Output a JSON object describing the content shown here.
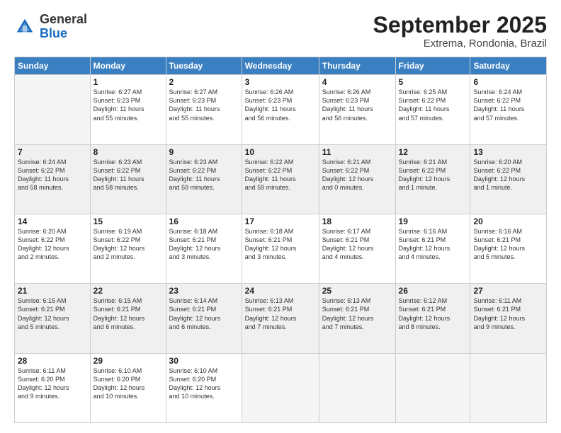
{
  "header": {
    "logo_general": "General",
    "logo_blue": "Blue",
    "month_title": "September 2025",
    "subtitle": "Extrema, Rondonia, Brazil"
  },
  "days_of_week": [
    "Sunday",
    "Monday",
    "Tuesday",
    "Wednesday",
    "Thursday",
    "Friday",
    "Saturday"
  ],
  "weeks": [
    [
      {
        "day": "",
        "info": ""
      },
      {
        "day": "1",
        "info": "Sunrise: 6:27 AM\nSunset: 6:23 PM\nDaylight: 11 hours\nand 55 minutes."
      },
      {
        "day": "2",
        "info": "Sunrise: 6:27 AM\nSunset: 6:23 PM\nDaylight: 11 hours\nand 55 minutes."
      },
      {
        "day": "3",
        "info": "Sunrise: 6:26 AM\nSunset: 6:23 PM\nDaylight: 11 hours\nand 56 minutes."
      },
      {
        "day": "4",
        "info": "Sunrise: 6:26 AM\nSunset: 6:23 PM\nDaylight: 11 hours\nand 56 minutes."
      },
      {
        "day": "5",
        "info": "Sunrise: 6:25 AM\nSunset: 6:22 PM\nDaylight: 11 hours\nand 57 minutes."
      },
      {
        "day": "6",
        "info": "Sunrise: 6:24 AM\nSunset: 6:22 PM\nDaylight: 11 hours\nand 57 minutes."
      }
    ],
    [
      {
        "day": "7",
        "info": "Sunrise: 6:24 AM\nSunset: 6:22 PM\nDaylight: 11 hours\nand 58 minutes."
      },
      {
        "day": "8",
        "info": "Sunrise: 6:23 AM\nSunset: 6:22 PM\nDaylight: 11 hours\nand 58 minutes."
      },
      {
        "day": "9",
        "info": "Sunrise: 6:23 AM\nSunset: 6:22 PM\nDaylight: 11 hours\nand 59 minutes."
      },
      {
        "day": "10",
        "info": "Sunrise: 6:22 AM\nSunset: 6:22 PM\nDaylight: 11 hours\nand 59 minutes."
      },
      {
        "day": "11",
        "info": "Sunrise: 6:21 AM\nSunset: 6:22 PM\nDaylight: 12 hours\nand 0 minutes."
      },
      {
        "day": "12",
        "info": "Sunrise: 6:21 AM\nSunset: 6:22 PM\nDaylight: 12 hours\nand 1 minute."
      },
      {
        "day": "13",
        "info": "Sunrise: 6:20 AM\nSunset: 6:22 PM\nDaylight: 12 hours\nand 1 minute."
      }
    ],
    [
      {
        "day": "14",
        "info": "Sunrise: 6:20 AM\nSunset: 6:22 PM\nDaylight: 12 hours\nand 2 minutes."
      },
      {
        "day": "15",
        "info": "Sunrise: 6:19 AM\nSunset: 6:22 PM\nDaylight: 12 hours\nand 2 minutes."
      },
      {
        "day": "16",
        "info": "Sunrise: 6:18 AM\nSunset: 6:21 PM\nDaylight: 12 hours\nand 3 minutes."
      },
      {
        "day": "17",
        "info": "Sunrise: 6:18 AM\nSunset: 6:21 PM\nDaylight: 12 hours\nand 3 minutes."
      },
      {
        "day": "18",
        "info": "Sunrise: 6:17 AM\nSunset: 6:21 PM\nDaylight: 12 hours\nand 4 minutes."
      },
      {
        "day": "19",
        "info": "Sunrise: 6:16 AM\nSunset: 6:21 PM\nDaylight: 12 hours\nand 4 minutes."
      },
      {
        "day": "20",
        "info": "Sunrise: 6:16 AM\nSunset: 6:21 PM\nDaylight: 12 hours\nand 5 minutes."
      }
    ],
    [
      {
        "day": "21",
        "info": "Sunrise: 6:15 AM\nSunset: 6:21 PM\nDaylight: 12 hours\nand 5 minutes."
      },
      {
        "day": "22",
        "info": "Sunrise: 6:15 AM\nSunset: 6:21 PM\nDaylight: 12 hours\nand 6 minutes."
      },
      {
        "day": "23",
        "info": "Sunrise: 6:14 AM\nSunset: 6:21 PM\nDaylight: 12 hours\nand 6 minutes."
      },
      {
        "day": "24",
        "info": "Sunrise: 6:13 AM\nSunset: 6:21 PM\nDaylight: 12 hours\nand 7 minutes."
      },
      {
        "day": "25",
        "info": "Sunrise: 6:13 AM\nSunset: 6:21 PM\nDaylight: 12 hours\nand 7 minutes."
      },
      {
        "day": "26",
        "info": "Sunrise: 6:12 AM\nSunset: 6:21 PM\nDaylight: 12 hours\nand 8 minutes."
      },
      {
        "day": "27",
        "info": "Sunrise: 6:11 AM\nSunset: 6:21 PM\nDaylight: 12 hours\nand 9 minutes."
      }
    ],
    [
      {
        "day": "28",
        "info": "Sunrise: 6:11 AM\nSunset: 6:20 PM\nDaylight: 12 hours\nand 9 minutes."
      },
      {
        "day": "29",
        "info": "Sunrise: 6:10 AM\nSunset: 6:20 PM\nDaylight: 12 hours\nand 10 minutes."
      },
      {
        "day": "30",
        "info": "Sunrise: 6:10 AM\nSunset: 6:20 PM\nDaylight: 12 hours\nand 10 minutes."
      },
      {
        "day": "",
        "info": ""
      },
      {
        "day": "",
        "info": ""
      },
      {
        "day": "",
        "info": ""
      },
      {
        "day": "",
        "info": ""
      }
    ]
  ]
}
